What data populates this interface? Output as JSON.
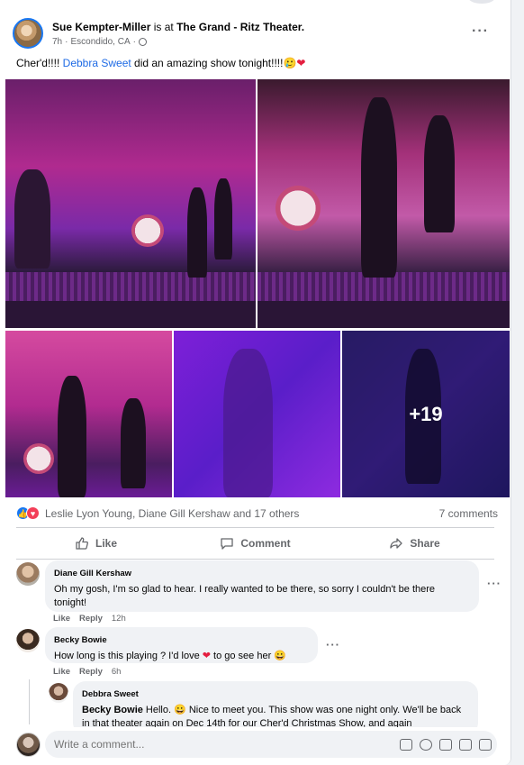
{
  "post": {
    "author": "Sue Kempter-Miller",
    "checkin_verb": "is at",
    "place": "The Grand - Ritz Theater.",
    "time": "7h",
    "location": "Escondido, CA",
    "text_before": "Cher'd!!!! ",
    "mention": "Debbra Sweet",
    "text_after": " did an amazing show tonight!!!!🥲",
    "heart": "❤",
    "more_photos": "+19"
  },
  "reactions": {
    "names": "Leslie Lyon Young, Diane Gill Kershaw and 17 others",
    "comments_count": "7 comments"
  },
  "actions": {
    "like": "Like",
    "comment": "Comment",
    "share": "Share"
  },
  "comments": [
    {
      "name": "Diane Gill Kershaw",
      "text": "Oh my gosh, I'm so glad to hear. I really wanted to be there, so sorry I couldn't be there tonight!",
      "like": "Like",
      "reply": "Reply",
      "time": "12h"
    },
    {
      "name": "Becky Bowie",
      "text_before": "How long is this playing ? I'd love ",
      "heart": "❤",
      "text_after": " to go see her 😀",
      "like": "Like",
      "reply": "Reply",
      "time": "6h"
    },
    {
      "name": "Debbra Sweet",
      "mention": "Becky Bowie",
      "text": " Hello. 😀 Nice to meet you. This show was one night only. We'll be back in that theater again on Dec 14th for our Cher'd Christmas Show, and again"
    }
  ],
  "composer": {
    "placeholder": "Write a comment..."
  },
  "colors": {
    "accent": "#1877f2",
    "link": "#1d6ae5",
    "love": "#f33e58",
    "secondary_text": "#65676b"
  }
}
